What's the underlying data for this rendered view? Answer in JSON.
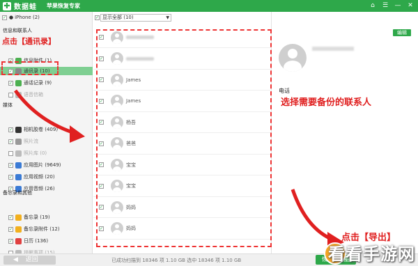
{
  "app": {
    "logo_mark": "✚",
    "logo_name": "数据蛙",
    "subtitle": "苹果恢复专家",
    "win_controls": [
      "⌂",
      "☰",
      "—",
      "✕"
    ],
    "accent": "#2ea84a"
  },
  "left": {
    "device": "iPhone (2)",
    "sections": [
      {
        "title": "信息和联系人"
      },
      {
        "title": "媒体"
      },
      {
        "title": "备忘录和其他"
      }
    ],
    "items": [
      {
        "label": "信息附件 (1)",
        "checked": true,
        "icon_color": "#4cb050"
      },
      {
        "label": "通讯录 (10)",
        "checked": true,
        "icon_color": "#888888",
        "selected": true
      },
      {
        "label": "通话记录 (9)",
        "checked": true,
        "icon_color": "#4cb050"
      },
      {
        "label": "语音信箱",
        "checked": false,
        "icon_color": "#bbbbbb",
        "dim": true
      },
      {
        "label": "相机胶卷 (409)",
        "checked": true,
        "icon_color": "#333333"
      },
      {
        "label": "照片流",
        "checked": true,
        "icon_color": "#999999",
        "dim": true
      },
      {
        "label": "照片库 (0)",
        "checked": false,
        "icon_color": "#bbbbbb",
        "dim": true
      },
      {
        "label": "应用图片 (9649)",
        "checked": true,
        "icon_color": "#3a7bd5"
      },
      {
        "label": "应用视频 (20)",
        "checked": true,
        "icon_color": "#3a7bd5"
      },
      {
        "label": "应用音频 (26)",
        "checked": true,
        "icon_color": "#3a7bd5"
      },
      {
        "label": "备忘录 (19)",
        "checked": true,
        "icon_color": "#f2b01e"
      },
      {
        "label": "备忘录附件 (12)",
        "checked": true,
        "icon_color": "#f2b01e"
      },
      {
        "label": "日历 (136)",
        "checked": true,
        "icon_color": "#e04040"
      },
      {
        "label": "提醒事项 (15)",
        "checked": false,
        "icon_color": "#bbbbbb",
        "dim": true
      }
    ],
    "annotation": "点击【通讯录】"
  },
  "middle": {
    "filter_value": "显示全部 (10)",
    "contacts": [
      {
        "name": "",
        "blurred": true
      },
      {
        "name": "",
        "blurred": true
      },
      {
        "name": "James"
      },
      {
        "name": "James"
      },
      {
        "name": "杨吾"
      },
      {
        "name": "爸爸"
      },
      {
        "name": "宝宝"
      },
      {
        "name": "宝宝"
      },
      {
        "name": "妈妈"
      },
      {
        "name": "妈妈"
      }
    ]
  },
  "right": {
    "edit_label": "编辑",
    "phone_label": "电话",
    "annotation": "选择需要备份的联系人"
  },
  "bottom": {
    "back_label": "返回",
    "back_arrow": "◀",
    "status": "已成功扫描到 18346 项 1.10 GB  选中 18346 项 1.10 GB",
    "export_label": "恢复到电脑",
    "export_annotation": "点击【导出】",
    "watermark": "看看手游网"
  }
}
